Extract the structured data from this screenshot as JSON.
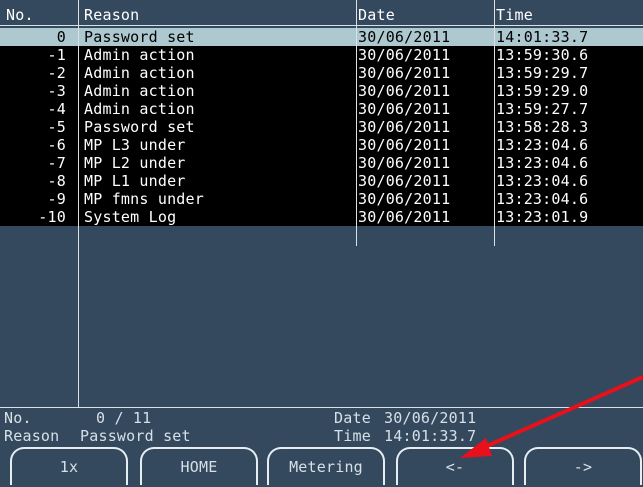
{
  "table": {
    "headers": {
      "no": "No.",
      "reason": "Reason",
      "date": "Date",
      "time": "Time"
    },
    "rows": [
      {
        "no": "0",
        "reason": "Password set",
        "date": "30/06/2011",
        "time": "14:01:33.7"
      },
      {
        "no": "-1",
        "reason": "Admin action",
        "date": "30/06/2011",
        "time": "13:59:30.6"
      },
      {
        "no": "-2",
        "reason": "Admin action",
        "date": "30/06/2011",
        "time": "13:59:29.7"
      },
      {
        "no": "-3",
        "reason": "Admin action",
        "date": "30/06/2011",
        "time": "13:59:29.0"
      },
      {
        "no": "-4",
        "reason": "Admin action",
        "date": "30/06/2011",
        "time": "13:59:27.7"
      },
      {
        "no": "-5",
        "reason": "Password set",
        "date": "30/06/2011",
        "time": "13:58:28.3"
      },
      {
        "no": "-6",
        "reason": "MP L3 under",
        "date": "30/06/2011",
        "time": "13:23:04.6"
      },
      {
        "no": "-7",
        "reason": "MP L2 under",
        "date": "30/06/2011",
        "time": "13:23:04.6"
      },
      {
        "no": "-8",
        "reason": "MP L1 under",
        "date": "30/06/2011",
        "time": "13:23:04.6"
      },
      {
        "no": "-9",
        "reason": "MP fmns under",
        "date": "30/06/2011",
        "time": "13:23:04.6"
      },
      {
        "no": "-10",
        "reason": "System Log",
        "date": "30/06/2011",
        "time": "13:23:01.9"
      }
    ]
  },
  "info": {
    "no_label": "No.",
    "no_value": "0 / 11",
    "reason_label": "Reason",
    "reason_value": "Password set",
    "date_label": "Date",
    "date_value": "30/06/2011",
    "time_label": "Time",
    "time_value": "14:01:33.7"
  },
  "buttons": {
    "b1": "1x",
    "b2": "HOME",
    "b3": "Metering",
    "b4": "<-",
    "b5": "->"
  },
  "colors": {
    "background": "#34495e",
    "row_background": "#000000",
    "selected_row": "#adc8cf",
    "annotation_arrow": "#e8101a"
  }
}
